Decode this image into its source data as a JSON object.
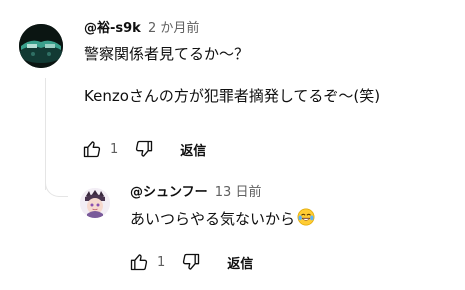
{
  "comment": {
    "author": "@裕-s9k",
    "time": "2 か月前",
    "lines": [
      "警察関係者見てるか～？",
      "Kenzoさんの方が犯罪者摘発してるぞ～(笑)"
    ],
    "likes": "1",
    "reply_label": "返信"
  },
  "reply_comment": {
    "author": "@シュンフー",
    "time": "13 日前",
    "text": "あいつらやる気ないから",
    "emoji": "face-with-tears-of-joy",
    "likes": "1",
    "reply_label": "返信"
  },
  "colors": {
    "text": "#0f0f0f",
    "secondary": "#606060",
    "thread_line": "#e5e5e5"
  }
}
